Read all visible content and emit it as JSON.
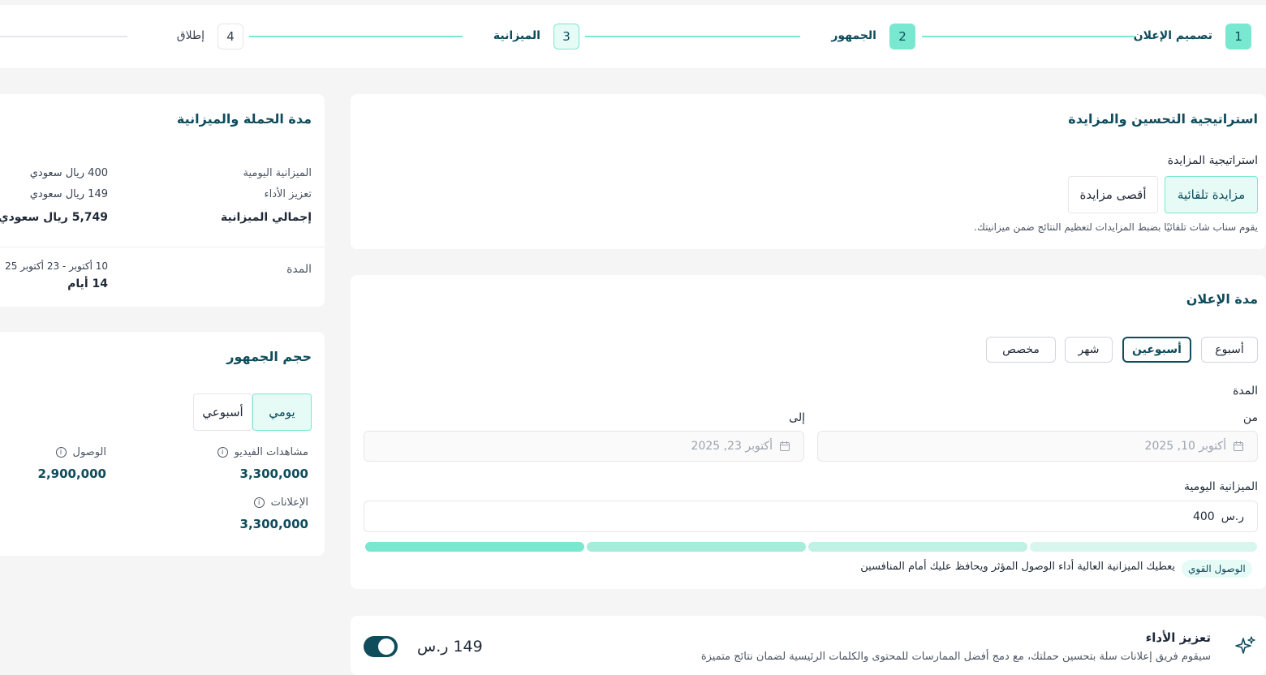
{
  "stepper": {
    "steps": [
      {
        "num": "1",
        "label": "تصميم الإعلان"
      },
      {
        "num": "2",
        "label": "الجمهور"
      },
      {
        "num": "3",
        "label": "الميزانية"
      },
      {
        "num": "4",
        "label": "إطلاق"
      }
    ]
  },
  "bidding": {
    "title": "استراتيجية التحسين والمزايدة",
    "label": "استراتيجية المزايدة",
    "options": [
      "مزايدة تلقائية",
      "أقصى مزايدة"
    ],
    "selected": "مزايدة تلقائية",
    "hint": "يقوم سناب شات تلقائيًا بضبط المزايدات لتعظيم النتائج ضمن ميزانيتك."
  },
  "duration": {
    "title": "مدة الإعلان",
    "presets": [
      "أسبوع",
      "أسبوعين",
      "شهر",
      "مخصص"
    ],
    "selected": "أسبوعين",
    "period_label": "المدة",
    "from_label": "من",
    "to_label": "إلى",
    "from_value": "أكتوبر 10, 2025",
    "to_value": "أكتوبر 23, 2025",
    "daily_budget_label": "الميزانية اليومية",
    "daily_budget_value": "400",
    "currency": "ر.س",
    "budget_level": 0.25,
    "reach_badge": "الوصول القوي",
    "reach_text": "يعطيك الميزانية العالية أداء الوصول المؤثر ويحافظ عليك أمام المنافسين"
  },
  "boost": {
    "title": "تعزيز الأداء",
    "description": "سيقوم فريق إعلانات سلة بتحسين حملتك، مع دمج أفضل الممارسات للمحتوى والكلمات الرئيسية لضمان نتائج متميزة",
    "price": "149 ر.س",
    "enabled": true
  },
  "summary": {
    "title": "مدة الحملة والميزانية",
    "daily_label": "الميزانية اليومية",
    "daily_value": "400 ريال سعودي",
    "boost_label": "تعزيز الأداء",
    "boost_value": "149 ريال سعودي",
    "total_label": "إجمالي الميزانية",
    "total_value": "5,749 ريال سعودي",
    "duration_label": "المدة",
    "duration_range": "10 أكتوبر - 23 أكتوبر 25",
    "duration_days": "14 أيام"
  },
  "audience": {
    "title": "حجم الجمهور",
    "tabs": [
      "يومي",
      "أسبوعي"
    ],
    "selected": "يومي",
    "video_views_label": "مشاهدات الفيديو",
    "video_views_value": "3,300,000",
    "reach_label": "الوصول",
    "reach_value": "2,900,000",
    "ads_label": "الإعلانات",
    "ads_value": "3,300,000"
  },
  "colors": {
    "accent": "#79e8d0",
    "accent_light": "#e6fbf6",
    "dark": "#0f4c5c"
  },
  "icons": [
    "calendar-icon",
    "info-icon",
    "sparkles-icon"
  ]
}
